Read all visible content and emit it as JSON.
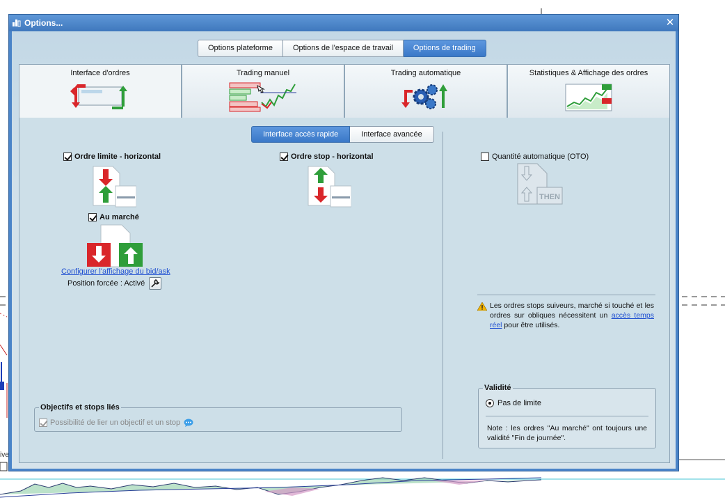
{
  "window": {
    "title": "Options..."
  },
  "top_tabs": [
    {
      "label": "Options plateforme",
      "active": false
    },
    {
      "label": "Options de l'espace de travail",
      "active": false
    },
    {
      "label": "Options de trading",
      "active": true
    }
  ],
  "big_tabs": [
    {
      "label": "Interface d'ordres",
      "active": true
    },
    {
      "label": "Trading manuel",
      "active": false
    },
    {
      "label": "Trading automatique",
      "active": false
    },
    {
      "label": "Statistiques & Affichage des ordres",
      "active": false
    }
  ],
  "sub_tabs": [
    {
      "label": "Interface accès rapide",
      "active": true
    },
    {
      "label": "Interface avancée",
      "active": false
    }
  ],
  "order_options": {
    "limit_horizontal": {
      "label": "Ordre limite - horizontal",
      "checked": true
    },
    "stop_horizontal": {
      "label": "Ordre stop - horizontal",
      "checked": true
    },
    "market": {
      "label": "Au marché",
      "checked": true
    },
    "auto_quantity": {
      "label": "Quantité automatique (OTO)",
      "checked": false
    },
    "then_icon_label": "THEN"
  },
  "bid_ask_link": "Configurer l'affichage du bid/ask",
  "forced_position": "Position forcée : Activé",
  "objectives_group": {
    "legend": "Objectifs et stops liés",
    "option_label": "Possibilité de lier un objectif et un stop",
    "checked": true,
    "disabled": true
  },
  "warning": {
    "text_before": "Les ordres stops suiveurs, marché si touché et les ordres sur obliques nécessitent un ",
    "link": "accès temps réel",
    "text_after": " pour être utilisés."
  },
  "validity_group": {
    "legend": "Validité",
    "option_label": "Pas de limite",
    "selected": true,
    "note": "Note : les ordres \"Au marché\" ont toujours une validité \"Fin de journée\"."
  },
  "background_chart": {
    "left_label": "ive"
  },
  "colors": {
    "accent_blue": "#3a78c8",
    "title_bar": "#4a84c8",
    "panel_bg": "#cddfe8",
    "sell_red": "#d9262a",
    "buy_green": "#2f9e3a"
  }
}
